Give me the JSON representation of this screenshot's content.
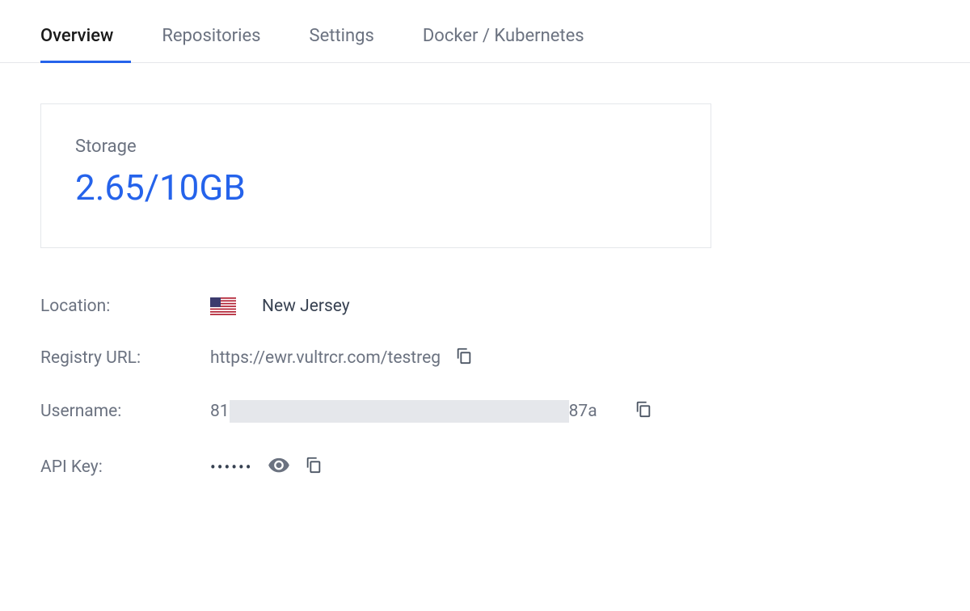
{
  "tabs": [
    {
      "label": "Overview",
      "active": true
    },
    {
      "label": "Repositories",
      "active": false
    },
    {
      "label": "Settings",
      "active": false
    },
    {
      "label": "Docker / Kubernetes",
      "active": false
    }
  ],
  "storage": {
    "label": "Storage",
    "value": "2.65/10GB"
  },
  "details": {
    "location_label": "Location:",
    "location_value": "New Jersey",
    "registry_url_label": "Registry URL:",
    "registry_url_value": "https://ewr.vultrcr.com/testreg",
    "username_label": "Username:",
    "username_start": "81",
    "username_end": "87a",
    "api_key_label": "API Key:",
    "api_key_masked": "••••••"
  }
}
